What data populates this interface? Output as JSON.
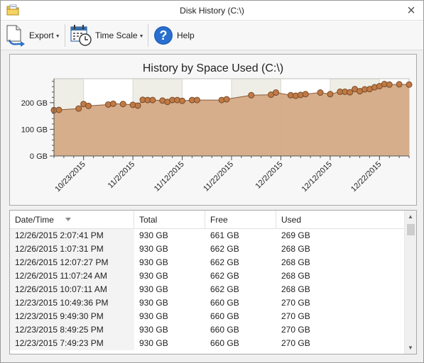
{
  "window": {
    "title": "Disk History (C:\\)"
  },
  "toolbar": {
    "export_label": "Export",
    "timescale_label": "Time Scale",
    "help_label": "Help"
  },
  "chart_data": {
    "type": "area",
    "title": "History by Space Used (C:\\)",
    "yticks": [
      "0 GB",
      "100 GB",
      "200 GB"
    ],
    "ylim": [
      0,
      290
    ],
    "xlim": [
      "2015-10-17",
      "2015-12-28"
    ],
    "xticks": [
      "10/23/2015",
      "11/2/2015",
      "11/12/2015",
      "11/22/2015",
      "12/2/2015",
      "12/12/2015",
      "12/22/2015"
    ],
    "fill_color": "#d4aa86",
    "line_color": "#8b5a3a",
    "marker_color": "#c07a45",
    "points": [
      {
        "x": "2015-10-17",
        "y": 172
      },
      {
        "x": "2015-10-18",
        "y": 173
      },
      {
        "x": "2015-10-22",
        "y": 178
      },
      {
        "x": "2015-10-23",
        "y": 195
      },
      {
        "x": "2015-10-24",
        "y": 188
      },
      {
        "x": "2015-10-28",
        "y": 193
      },
      {
        "x": "2015-10-29",
        "y": 196
      },
      {
        "x": "2015-10-31",
        "y": 195
      },
      {
        "x": "2015-11-02",
        "y": 192
      },
      {
        "x": "2015-11-03",
        "y": 189
      },
      {
        "x": "2015-11-04",
        "y": 211
      },
      {
        "x": "2015-11-05",
        "y": 210
      },
      {
        "x": "2015-11-06",
        "y": 210
      },
      {
        "x": "2015-11-08",
        "y": 208
      },
      {
        "x": "2015-11-09",
        "y": 203
      },
      {
        "x": "2015-11-10",
        "y": 210
      },
      {
        "x": "2015-11-11",
        "y": 210
      },
      {
        "x": "2015-11-12",
        "y": 207
      },
      {
        "x": "2015-11-14",
        "y": 210
      },
      {
        "x": "2015-11-15",
        "y": 210
      },
      {
        "x": "2015-11-20",
        "y": 210
      },
      {
        "x": "2015-11-21",
        "y": 213
      },
      {
        "x": "2015-11-26",
        "y": 228
      },
      {
        "x": "2015-11-30",
        "y": 230
      },
      {
        "x": "2015-12-01",
        "y": 238
      },
      {
        "x": "2015-12-04",
        "y": 228
      },
      {
        "x": "2015-12-05",
        "y": 226
      },
      {
        "x": "2015-12-06",
        "y": 229
      },
      {
        "x": "2015-12-07",
        "y": 232
      },
      {
        "x": "2015-12-10",
        "y": 238
      },
      {
        "x": "2015-12-12",
        "y": 232
      },
      {
        "x": "2015-12-14",
        "y": 241
      },
      {
        "x": "2015-12-15",
        "y": 241
      },
      {
        "x": "2015-12-16",
        "y": 239
      },
      {
        "x": "2015-12-17",
        "y": 251
      },
      {
        "x": "2015-12-18",
        "y": 243
      },
      {
        "x": "2015-12-19",
        "y": 250
      },
      {
        "x": "2015-12-20",
        "y": 251
      },
      {
        "x": "2015-12-21",
        "y": 258
      },
      {
        "x": "2015-12-22",
        "y": 262
      },
      {
        "x": "2015-12-23",
        "y": 270
      },
      {
        "x": "2015-12-24",
        "y": 268
      },
      {
        "x": "2015-12-26",
        "y": 269
      },
      {
        "x": "2015-12-28",
        "y": 268
      }
    ]
  },
  "grid": {
    "columns": [
      "Date/Time",
      "Total",
      "Free",
      "Used"
    ],
    "rows": [
      {
        "date": "12/26/2015 2:07:41 PM",
        "total": "930 GB",
        "free": "661 GB",
        "used": "269 GB"
      },
      {
        "date": "12/26/2015 1:07:31 PM",
        "total": "930 GB",
        "free": "662 GB",
        "used": "268 GB"
      },
      {
        "date": "12/26/2015 12:07:27 PM",
        "total": "930 GB",
        "free": "662 GB",
        "used": "268 GB"
      },
      {
        "date": "12/26/2015 11:07:24 AM",
        "total": "930 GB",
        "free": "662 GB",
        "used": "268 GB"
      },
      {
        "date": "12/26/2015 10:07:11 AM",
        "total": "930 GB",
        "free": "662 GB",
        "used": "268 GB"
      },
      {
        "date": "12/23/2015 10:49:36 PM",
        "total": "930 GB",
        "free": "660 GB",
        "used": "270 GB"
      },
      {
        "date": "12/23/2015 9:49:30 PM",
        "total": "930 GB",
        "free": "660 GB",
        "used": "270 GB"
      },
      {
        "date": "12/23/2015 8:49:25 PM",
        "total": "930 GB",
        "free": "660 GB",
        "used": "270 GB"
      },
      {
        "date": "12/23/2015 7:49:23 PM",
        "total": "930 GB",
        "free": "660 GB",
        "used": "270 GB"
      }
    ]
  },
  "icons": {
    "app": "folder-icon",
    "close": "close-icon",
    "export": "export-icon",
    "timescale": "calendar-clock-icon",
    "help": "help-icon",
    "sort": "sort-descending-icon"
  }
}
